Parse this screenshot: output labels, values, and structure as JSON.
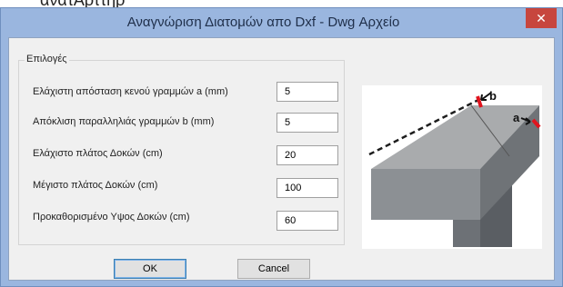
{
  "background_text": "ανατΑρττηρ",
  "window": {
    "title": "Αναγνώριση Διατομών απο Dxf - Dwg Αρχείο",
    "close_glyph": "✕"
  },
  "options": {
    "group_label": "Επιλογές",
    "rows": [
      {
        "label": "Ελάχιστη απόσταση κενού γραμμών a (mm)",
        "value": "5"
      },
      {
        "label": "Απόκλιση παραλληλιάς γραμμών b (mm)",
        "value": "5"
      },
      {
        "label": "Ελάχιστο πλάτος Δοκών (cm)",
        "value": "20"
      },
      {
        "label": "Μέγιστο πλάτος Δοκών (cm)",
        "value": "100"
      },
      {
        "label": "Προκαθορισμένο Υψος Δοκών (cm)",
        "value": "60"
      }
    ]
  },
  "illustration": {
    "label_a": "a",
    "label_b": "b"
  },
  "buttons": {
    "ok": "OK",
    "cancel": "Cancel"
  },
  "colors": {
    "title_bar": "#9ab6df",
    "close_button": "#c7463e",
    "marker_red": "#e0141e"
  }
}
